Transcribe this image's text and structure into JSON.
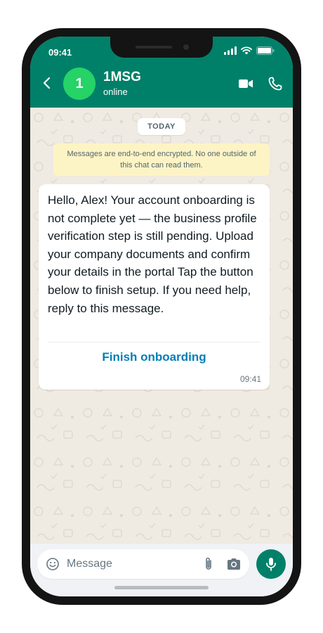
{
  "status_bar": {
    "time": "09:41"
  },
  "contact": {
    "avatar_initial": "1",
    "name": "1MSG",
    "status": "online"
  },
  "chat": {
    "date_chip": "TODAY",
    "encryption_notice": "Messages are end-to-end encrypted. No one outside of this chat can read them.",
    "message": {
      "text": "Hello, Alex! Your account onboarding is not complete yet — the business profile verification step is still pending. Upload your company documents and confirm your details in the portal Tap the button below to finish setup. If you need help, reply to this message.",
      "button_label": "Finish onboarding",
      "time": "09:41"
    }
  },
  "composer": {
    "placeholder": "Message"
  },
  "icons": {
    "back": "arrow-left-icon",
    "video": "video-call-icon",
    "phone": "phone-icon",
    "emoji": "emoji-icon",
    "attach": "paperclip-icon",
    "camera": "camera-icon",
    "mic": "microphone-icon"
  },
  "colors": {
    "header": "#008069",
    "avatar": "#25d366",
    "chat_bg": "#efeae2",
    "notice_bg": "#fdf4c5",
    "link": "#027eb5",
    "composer_bg": "#f0f2f5"
  }
}
